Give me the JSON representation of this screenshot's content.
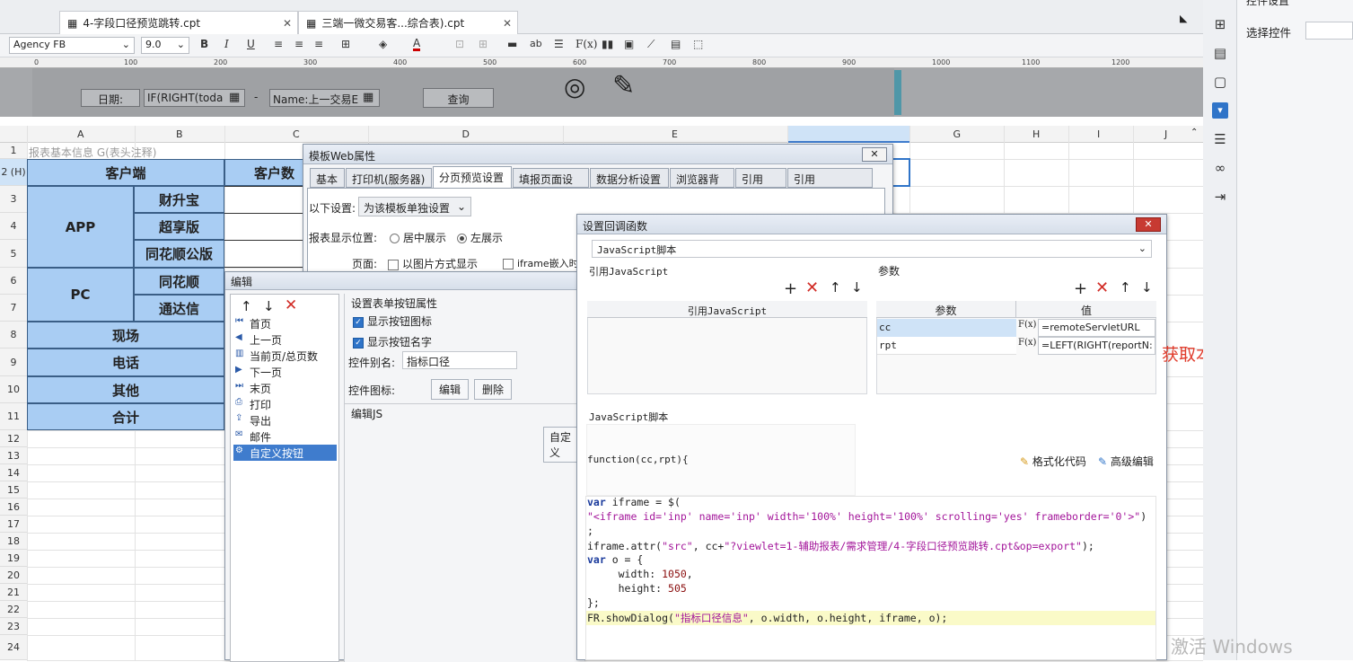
{
  "tabs": [
    {
      "label": "4-字段口径预览跳转.cpt"
    },
    {
      "label": "三端一微交易客...综合表).cpt"
    }
  ],
  "toolbar": {
    "font": "Agency FB",
    "size": "9.0"
  },
  "ruler": {
    "marks": [
      "0",
      "100",
      "200",
      "300",
      "400",
      "500",
      "600",
      "700",
      "800",
      "900",
      "1000",
      "1100",
      "1200"
    ]
  },
  "params": {
    "date_label": "日期:",
    "date_value": "IF(RIGHT(toda",
    "dash": "-",
    "name_value": "Name:上一交易E",
    "query_button": "查询"
  },
  "columns": [
    "A",
    "B",
    "C",
    "D",
    "E",
    "F",
    "G",
    "H",
    "I",
    "J"
  ],
  "rows": [
    "1",
    "2 (H)",
    "3",
    "4",
    "5",
    "6",
    "7",
    "8",
    "9",
    "10",
    "11",
    "12",
    "13",
    "14",
    "15",
    "16",
    "17",
    "18",
    "19",
    "20",
    "21",
    "22",
    "23",
    "24"
  ],
  "sheet": {
    "note": "报表基本信息 G(表头注释)",
    "header_client": "客户端",
    "header_count": "客户数",
    "app": "APP",
    "pc": "PC",
    "app_items": [
      "财升宝",
      "超享版",
      "同花顺公版"
    ],
    "pc_items": [
      "同花顺",
      "通达信"
    ],
    "rows_misc": [
      "现场",
      "电话",
      "其他",
      "合计"
    ]
  },
  "webprops": {
    "title": "模板Web属性",
    "tabs": [
      "基本",
      "打印机(服务器)",
      "分页预览设置",
      "填报页面设置",
      "数据分析设置",
      "浏览器背景",
      "引用Css",
      "引用JavaScript"
    ],
    "setting_label": "以下设置:",
    "setting_value": "为该模板单独设置",
    "position_label": "报表显示位置:",
    "center": "居中展示",
    "left": "左展示",
    "page_label": "页面:",
    "as_image": "以图片方式显示",
    "iframe": "iframe嵌入时"
  },
  "edit": {
    "title": "编辑",
    "items": [
      "首页",
      "上一页",
      "当前页/总页数",
      "下一页",
      "末页",
      "打印",
      "导出",
      "邮件",
      "自定义按钮"
    ],
    "group_label": "设置表单按钮属性",
    "show_icon": "显示按钮图标",
    "show_name": "显示按钮名字",
    "alias_label": "控件别名:",
    "alias_value": "指标口径",
    "icon_label": "控件图标:",
    "edit_btn": "编辑",
    "delete_btn": "删除",
    "js_label": "编辑JS",
    "custom_btn": "自定义"
  },
  "callback": {
    "title": "设置回调函数",
    "type": "JavaScript脚本",
    "ref_js_label": "引用JavaScript",
    "params_label": "参数",
    "ref_js_col": "引用JavaScript",
    "param_col": "参数",
    "value_col": "值",
    "params": [
      {
        "name": "cc",
        "fx": "F(x)",
        "value": "=remoteServletURL"
      },
      {
        "name": "rpt",
        "fx": "F(x)",
        "value": "=LEFT(RIGHT(reportN:"
      }
    ],
    "script_label": "JavaScript脚本",
    "func_sig": "function(cc,rpt){",
    "format_code": "格式化代码",
    "advanced_edit": "高级编辑",
    "code": [
      "var iframe = $(",
      "\"<iframe id='inp' name='inp' width='100%' height='100%' scrolling='yes' frameborder='0'>\")",
      ";",
      "iframe.attr(\"src\", cc+\"?viewlet=1-辅助报表/需求管理/4-字段口径预览跳转.cpt&op=export\");",
      "var o = {",
      "     width: 1050,",
      "     height: 505",
      "};",
      "FR.showDialog(\"指标口径信息\", o.width, o.height, iframe, o);"
    ]
  },
  "annotation": "获取本报表名称",
  "side": {
    "title": "控件设置",
    "select_label": "选择控件"
  },
  "watermark": "激活 Windows",
  "colors": {
    "cell_blue": "#a9cdf3",
    "select_blue": "#3f7ccd",
    "annotation_red": "#e03a2a"
  }
}
